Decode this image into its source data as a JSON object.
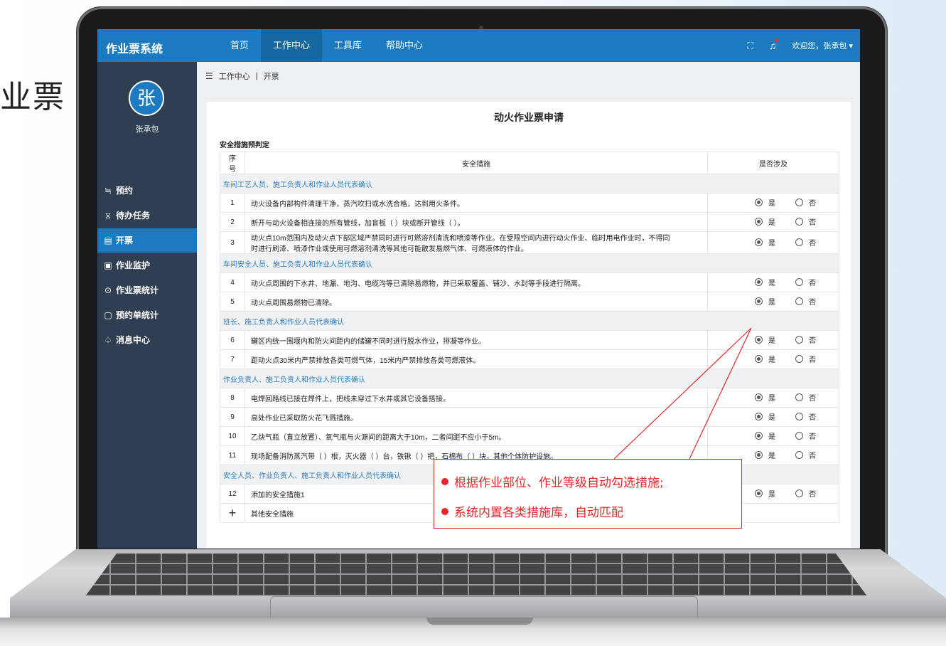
{
  "slide": {
    "title_fragment": "业票"
  },
  "app": {
    "brand": "作业票系统",
    "nav": [
      "首页",
      "工作中心",
      "工具库",
      "帮助中心"
    ],
    "nav_active": "工作中心",
    "welcome": "欢迎您，张承包",
    "icons": {
      "fullscreen": "fullscreen-icon",
      "bell": "bell-icon",
      "dropdown": "caret-down-icon"
    }
  },
  "sidebar": {
    "avatar_char": "张",
    "username": "张承包",
    "items": [
      {
        "icon": "≒",
        "label": "预约"
      },
      {
        "icon": "⧖",
        "label": "待办任务"
      },
      {
        "icon": "▤",
        "label": "开票"
      },
      {
        "icon": "▣",
        "label": "作业监护"
      },
      {
        "icon": "⊙",
        "label": "作业票统计"
      },
      {
        "icon": "▢",
        "label": "预约单统计"
      },
      {
        "icon": "♤",
        "label": "消息中心"
      }
    ],
    "active_item": "开票"
  },
  "breadcrumb": {
    "icon": "☰",
    "path": "工作中心",
    "separator": "|",
    "current": "开票"
  },
  "form": {
    "title": "动火作业票申请",
    "section": "安全措施预判定",
    "headers": {
      "no": "序号",
      "measure": "安全措施",
      "involved": "是否涉及"
    },
    "yes_label": "是",
    "no_label": "否",
    "groups": [
      {
        "title": "车间工艺人员、施工负责人和作业人员代表确认",
        "rows": [
          {
            "no": "1",
            "text": "动火设备内部构件清理干净，蒸汽吹扫或水洗合格，达到用火条件。",
            "selected": "yes"
          },
          {
            "no": "2",
            "text": "断开与动火设备相连接的所有管线，加盲板（ ）块或断开管线（ ）。",
            "selected": "yes"
          },
          {
            "no": "3",
            "text": "动火点10m范围内及动火点下部区域严禁同时进行可燃溶剂清洗和喷漆等作业。在受限空间内进行动火作业、临时用电作业时，不得同",
            "text2": "时进行刷漆、喷漆作业或使用可燃溶剂清洗等其他可能散发易燃气体、可燃液体的作业。",
            "selected": "yes"
          }
        ]
      },
      {
        "title": "车间安全人员、施工负责人和作业人员代表确认",
        "rows": [
          {
            "no": "4",
            "text": "动火点周围的下水井、地漏、地沟、电缆沟等已清除易燃物，并已采取覆盖、铺沙、水封等手段进行隔离。",
            "selected": "yes"
          },
          {
            "no": "5",
            "text": "动火点周围易燃物已清除。",
            "selected": "yes"
          }
        ]
      },
      {
        "title": "班长、施工负责人和作业人员代表确认",
        "rows": [
          {
            "no": "6",
            "text": "罐区内统一围堰内和防火间距内的储罐不同时进行脱水作业，排凝等作业。",
            "selected": "yes"
          },
          {
            "no": "7",
            "text": "距动火点30米内严禁排放各类可燃气体，15米内严禁排放各类可燃液体。",
            "selected": "yes"
          }
        ]
      },
      {
        "title": "作业负责人、施工负责人和作业人员代表确认",
        "rows": [
          {
            "no": "8",
            "text": "电焊回路线已接在焊件上，把线未穿过下水井或其它设备搭接。",
            "selected": "yes"
          },
          {
            "no": "9",
            "text": "高处作业已采取防火花飞溅措施。",
            "selected": "yes"
          },
          {
            "no": "10",
            "text": "乙炔气瓶（直立放置）、氧气瓶与火源间的距离大于10m，二者间距不应小于5m。",
            "selected": "yes"
          },
          {
            "no": "11",
            "text": "现场配备消防蒸汽带（ ）根，灭火器（ ）台，铁锹（ ）把，石棉布（ ）块，其他个体防护设施。",
            "selected": "yes"
          }
        ]
      },
      {
        "title": "安全人员、作业负责人、施工负责人和作业人员代表确认",
        "rows": [
          {
            "no": "12",
            "text": "添加的安全措施1",
            "selected": "yes",
            "deletable": true
          }
        ]
      }
    ],
    "add_label": "其他安全措施"
  },
  "callout": {
    "lines": [
      "根据作业部位、作业等级自动勾选措施;",
      "系统内置各类措施库，自动匹配"
    ],
    "color": "#e3262b"
  },
  "colors": {
    "primary": "#1c7bc0",
    "sidebar": "#2f3e51",
    "group_text": "#2d7fc1"
  }
}
